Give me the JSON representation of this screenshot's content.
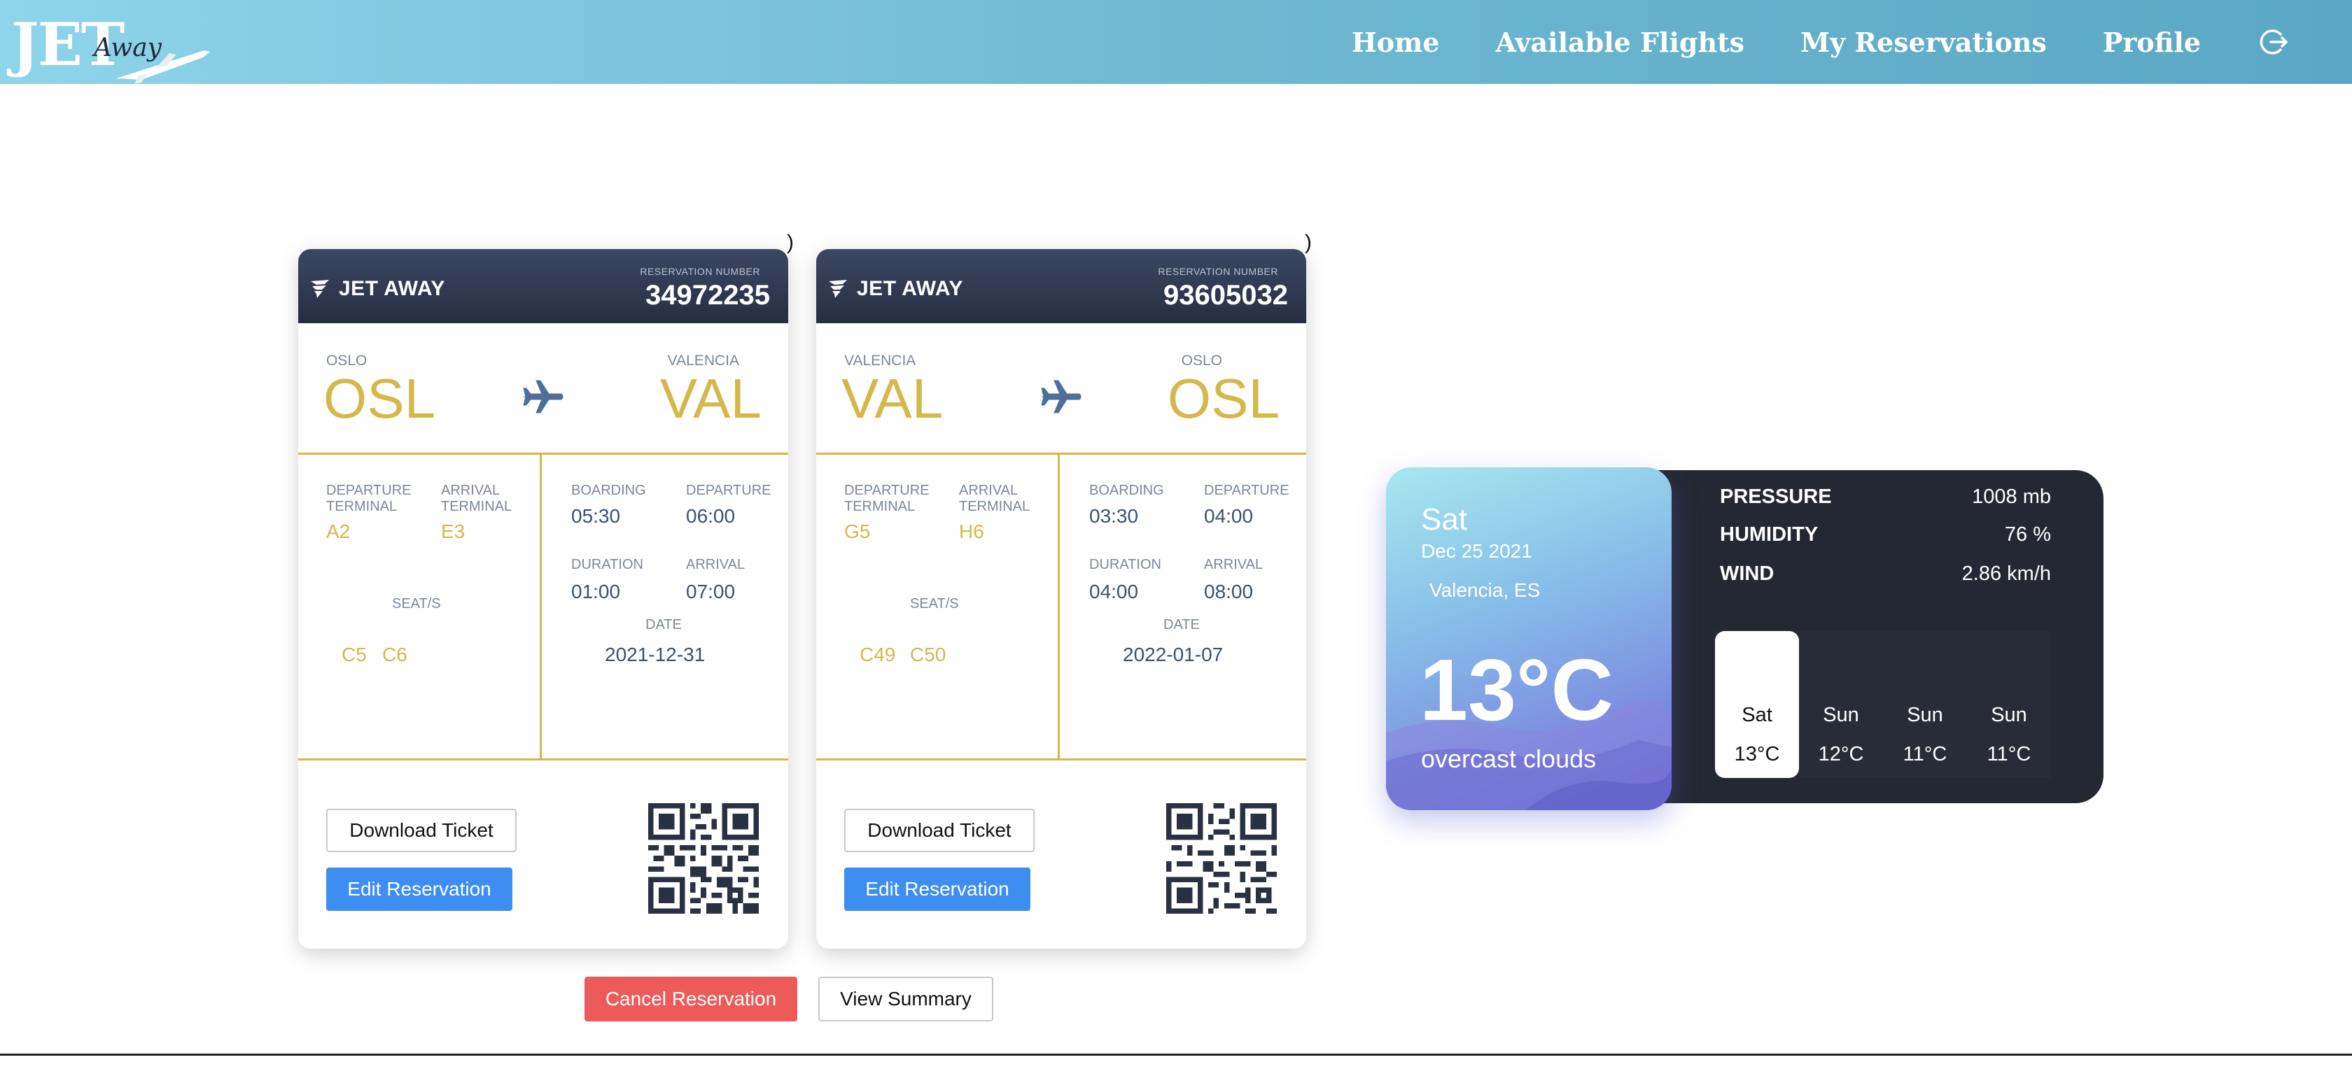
{
  "navbar": {
    "logo_main": "JET",
    "logo_script": "Away",
    "links": [
      "Home",
      "Available Flights",
      "My Reservations",
      "Profile"
    ]
  },
  "tickets": [
    {
      "brand": "JET AWAY",
      "reservation_label": "RESERVATION NUMBER",
      "reservation_number": "34972235",
      "from_city": "OSLO",
      "from_code": "OSL",
      "to_city": "VALENCIA",
      "to_code": "VAL",
      "departure_terminal_label": "DEPARTURE TERMINAL",
      "departure_terminal": "A2",
      "arrival_terminal_label": "ARRIVAL TERMINAL",
      "arrival_terminal": "E3",
      "seats_label": "SEAT/S",
      "seats": [
        "C5",
        "C6"
      ],
      "boarding_label": "BOARDING",
      "boarding": "05:30",
      "departure_label": "DEPARTURE",
      "departure": "06:00",
      "duration_label": "DURATION",
      "duration": "01:00",
      "arrival_label": "ARRIVAL",
      "arrival": "07:00",
      "date_label": "DATE",
      "date": "2021-12-31",
      "download_label": "Download Ticket",
      "edit_label": "Edit Reservation",
      "stray": ")"
    },
    {
      "brand": "JET AWAY",
      "reservation_label": "RESERVATION NUMBER",
      "reservation_number": "93605032",
      "from_city": "VALENCIA",
      "from_code": "VAL",
      "to_city": "OSLO",
      "to_code": "OSL",
      "departure_terminal_label": "DEPARTURE TERMINAL",
      "departure_terminal": "G5",
      "arrival_terminal_label": "ARRIVAL TERMINAL",
      "arrival_terminal": "H6",
      "seats_label": "SEAT/S",
      "seats": [
        "C49",
        "C50"
      ],
      "boarding_label": "BOARDING",
      "boarding": "03:30",
      "departure_label": "DEPARTURE",
      "departure": "04:00",
      "duration_label": "DURATION",
      "duration": "04:00",
      "arrival_label": "ARRIVAL",
      "arrival": "08:00",
      "date_label": "DATE",
      "date": "2022-01-07",
      "download_label": "Download Ticket",
      "edit_label": "Edit Reservation",
      "stray": ")"
    }
  ],
  "actions": {
    "cancel_label": "Cancel Reservation",
    "summary_label": "View Summary"
  },
  "weather": {
    "day": "Sat",
    "date": "Dec 25 2021",
    "location": "Valencia, ES",
    "temperature": "13°C",
    "description": "overcast clouds",
    "stats": [
      {
        "label": "PRESSURE",
        "value": "1008 mb"
      },
      {
        "label": "HUMIDITY",
        "value": "76 %"
      },
      {
        "label": "WIND",
        "value": "2.86 km/h"
      }
    ],
    "forecast": [
      {
        "day": "Sat",
        "temp": "13°C",
        "active": true
      },
      {
        "day": "Sun",
        "temp": "12°C",
        "active": false
      },
      {
        "day": "Sun",
        "temp": "11°C",
        "active": false
      },
      {
        "day": "Sun",
        "temp": "11°C",
        "active": false
      }
    ]
  },
  "colors": {
    "nav_gradient_start": "#8ed4ea",
    "nav_gradient_end": "#5aa8c4",
    "ticket_header": "#2c3448",
    "gold_accent": "#d4b84a",
    "value_blue": "#3a5270",
    "edit_button": "#3d8ef0",
    "cancel_button": "#ec5a5a",
    "weather_dark": "#242832"
  }
}
